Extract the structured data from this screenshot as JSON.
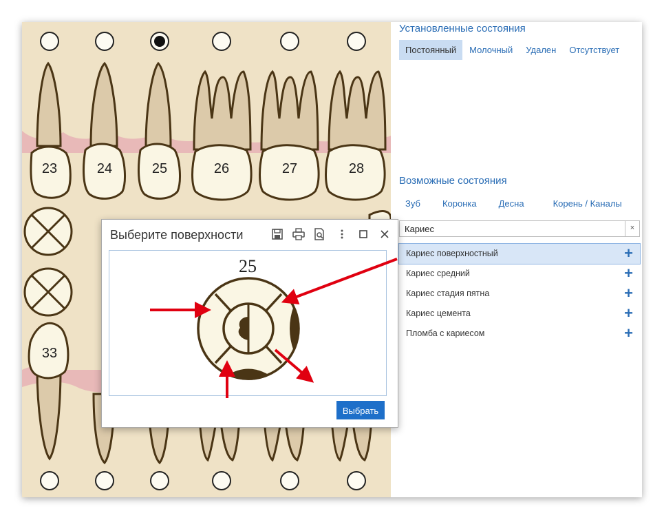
{
  "chart": {
    "upper_teeth": [
      "23",
      "24",
      "25",
      "26",
      "27",
      "28"
    ],
    "lower_tooth": "33"
  },
  "panel": {
    "installed_title": "Установленные состояния",
    "installed_tabs": [
      "Постоянный",
      "Молочный",
      "Удален",
      "Отсутствует"
    ],
    "possible_title": "Возможные состояния",
    "possible_tabs": [
      "Зуб",
      "Коронка",
      "Десна",
      "Корень / Каналы"
    ],
    "search": {
      "value": "Кариес",
      "clear": "×"
    },
    "items": [
      {
        "label": "Кариес поверхностный",
        "selected": true
      },
      {
        "label": "Кариес средний"
      },
      {
        "label": "Кариес стадия пятна"
      },
      {
        "label": "Кариес цемента"
      },
      {
        "label": "Пломба с кариесом"
      }
    ],
    "add_symbol": "+"
  },
  "dialog": {
    "title": "Выберите поверхности",
    "tooth": "25",
    "select_button": "Выбрать"
  },
  "colors": {
    "accent": "#2a6db5",
    "button": "#1e6fc9",
    "chart_bg": "#efe2c6",
    "gum": "#e8b9b8",
    "tooth": "#faf6e4",
    "outline": "#4a3515",
    "arrow": "#e00010"
  }
}
